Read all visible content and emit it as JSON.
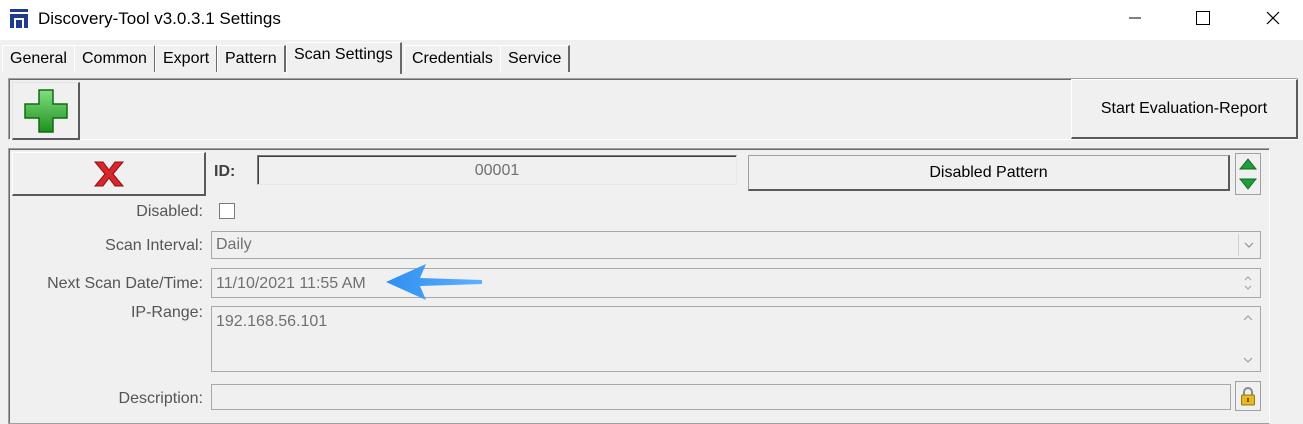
{
  "window": {
    "title": "Discovery-Tool v3.0.3.1 Settings",
    "app_icon": "discovery-tool-logo-icon",
    "controls": [
      "minimize-icon",
      "maximize-icon",
      "close-icon"
    ]
  },
  "tabs": [
    {
      "label": "General",
      "active": false
    },
    {
      "label": "Common",
      "active": false
    },
    {
      "label": "Export",
      "active": false
    },
    {
      "label": "Pattern",
      "active": false
    },
    {
      "label": "Scan Settings",
      "active": true
    },
    {
      "label": "Credentials",
      "active": false
    },
    {
      "label": "Service",
      "active": false
    }
  ],
  "toolbar": {
    "add_icon": "green-plus-icon",
    "report_label": "Start Evaluation-Report"
  },
  "pattern": {
    "delete_icon": "red-x-icon",
    "id_label": "ID:",
    "id_value": "00001",
    "disabled_pattern_label": "Disabled Pattern",
    "move_icons": [
      "green-up-arrow-icon",
      "green-down-arrow-icon"
    ],
    "disabled_label": "Disabled:",
    "disabled_checked": false,
    "scan_interval_label": "Scan Interval:",
    "scan_interval_value": "Daily",
    "next_scan_label": "Next Scan Date/Time:",
    "next_scan_value": "11/10/2021 11:55 AM",
    "ip_range_label": "IP-Range:",
    "ip_range_value": "192.168.56.101",
    "description_label": "Description:",
    "description_value": "",
    "lock_icon": "padlock-icon"
  },
  "annotation": {
    "arrow_icon": "blue-arrow-left-icon",
    "arrow_color": "#3399ff"
  },
  "colors": {
    "add_green": "#2fa62f",
    "delete_red": "#d9262c",
    "arrow_green": "#1f9d3a"
  }
}
